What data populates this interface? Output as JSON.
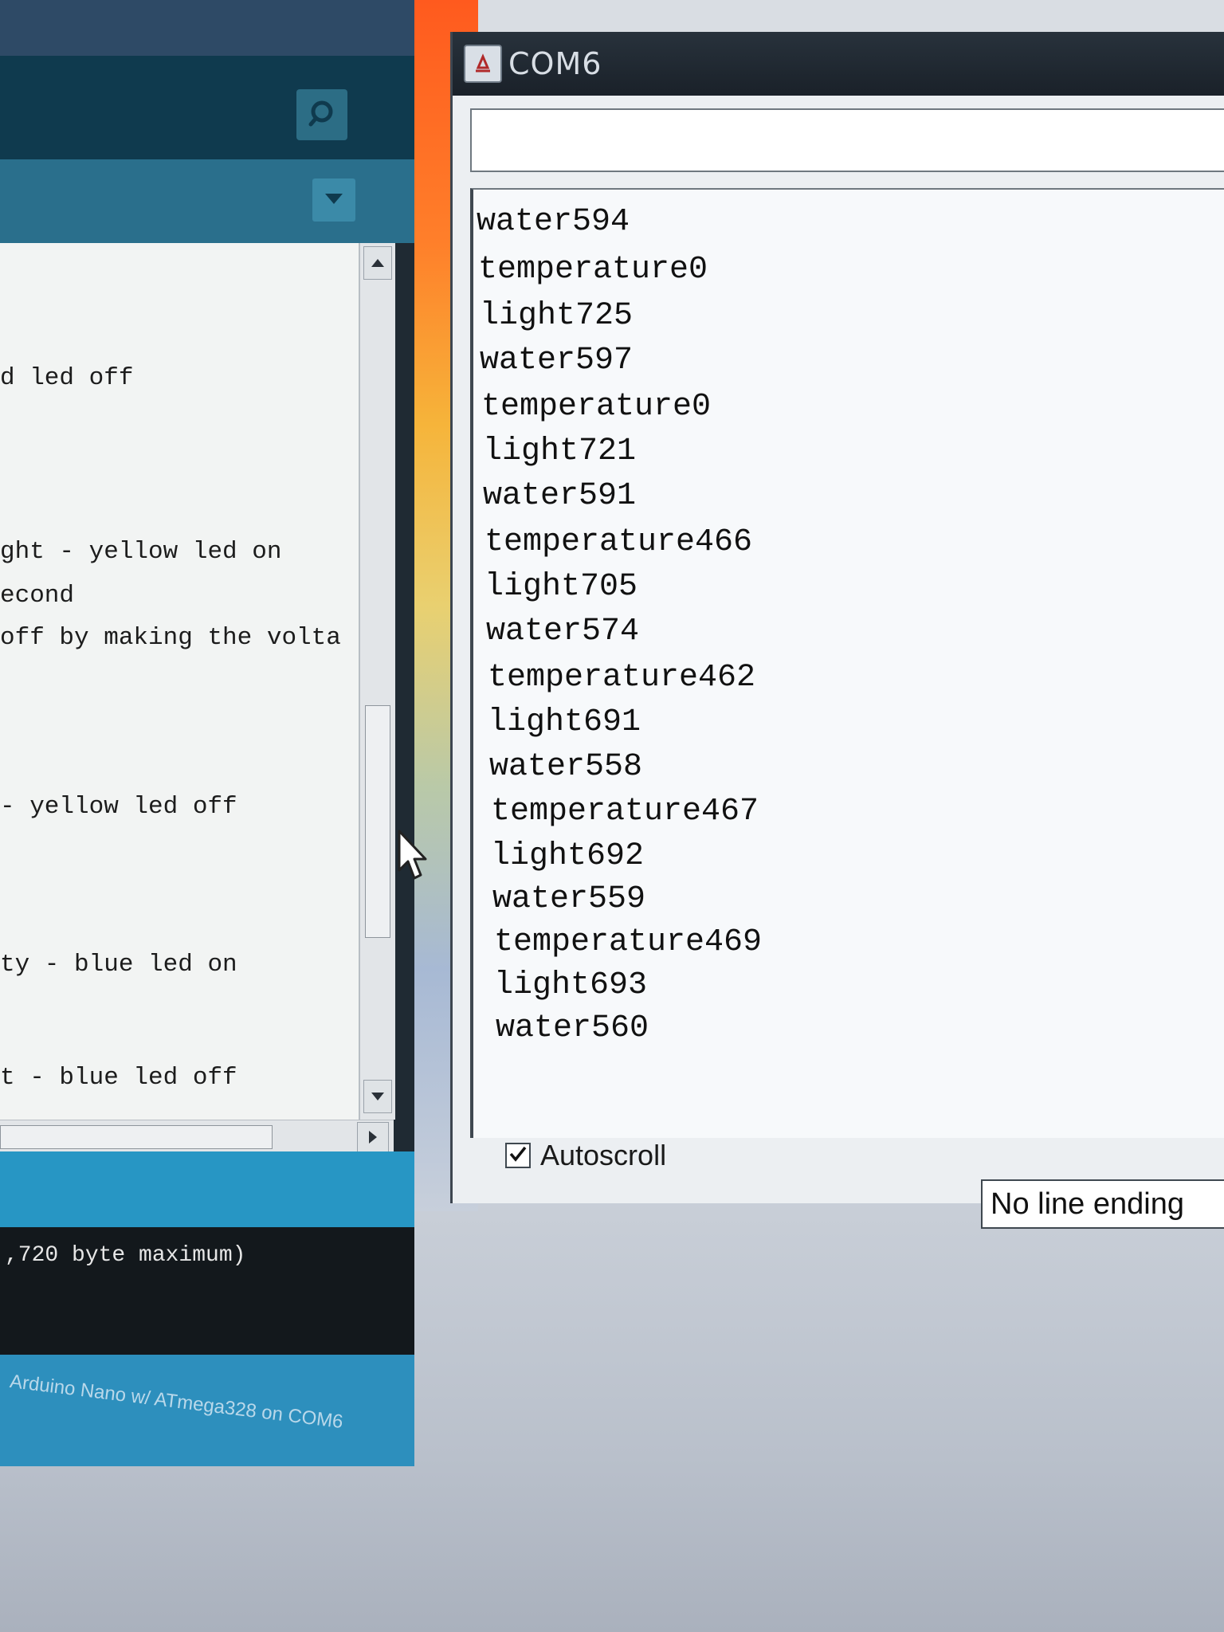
{
  "ide": {
    "code_lines": [
      "d led off",
      "ght - yellow led on",
      "econd",
      " off by making the volta",
      "- yellow led off",
      "ty - blue led on",
      "t - blue led off"
    ],
    "console_text": ",720 byte maximum)",
    "board_status": "Arduino Nano w/ ATmega328 on COM6"
  },
  "serial_monitor": {
    "title": "COM6",
    "send_input_value": "",
    "output_lines": [
      "water594",
      "temperature0",
      "light725",
      "water597",
      "temperature0",
      "light721",
      "water591",
      "temperature466",
      "light705",
      "water574",
      "temperature462",
      "light691",
      "water558",
      "temperature467",
      "light692",
      "water559",
      "temperature469",
      "light693",
      "water560"
    ],
    "autoscroll_label": "Autoscroll",
    "autoscroll_checked": true,
    "line_ending": "No line ending"
  }
}
